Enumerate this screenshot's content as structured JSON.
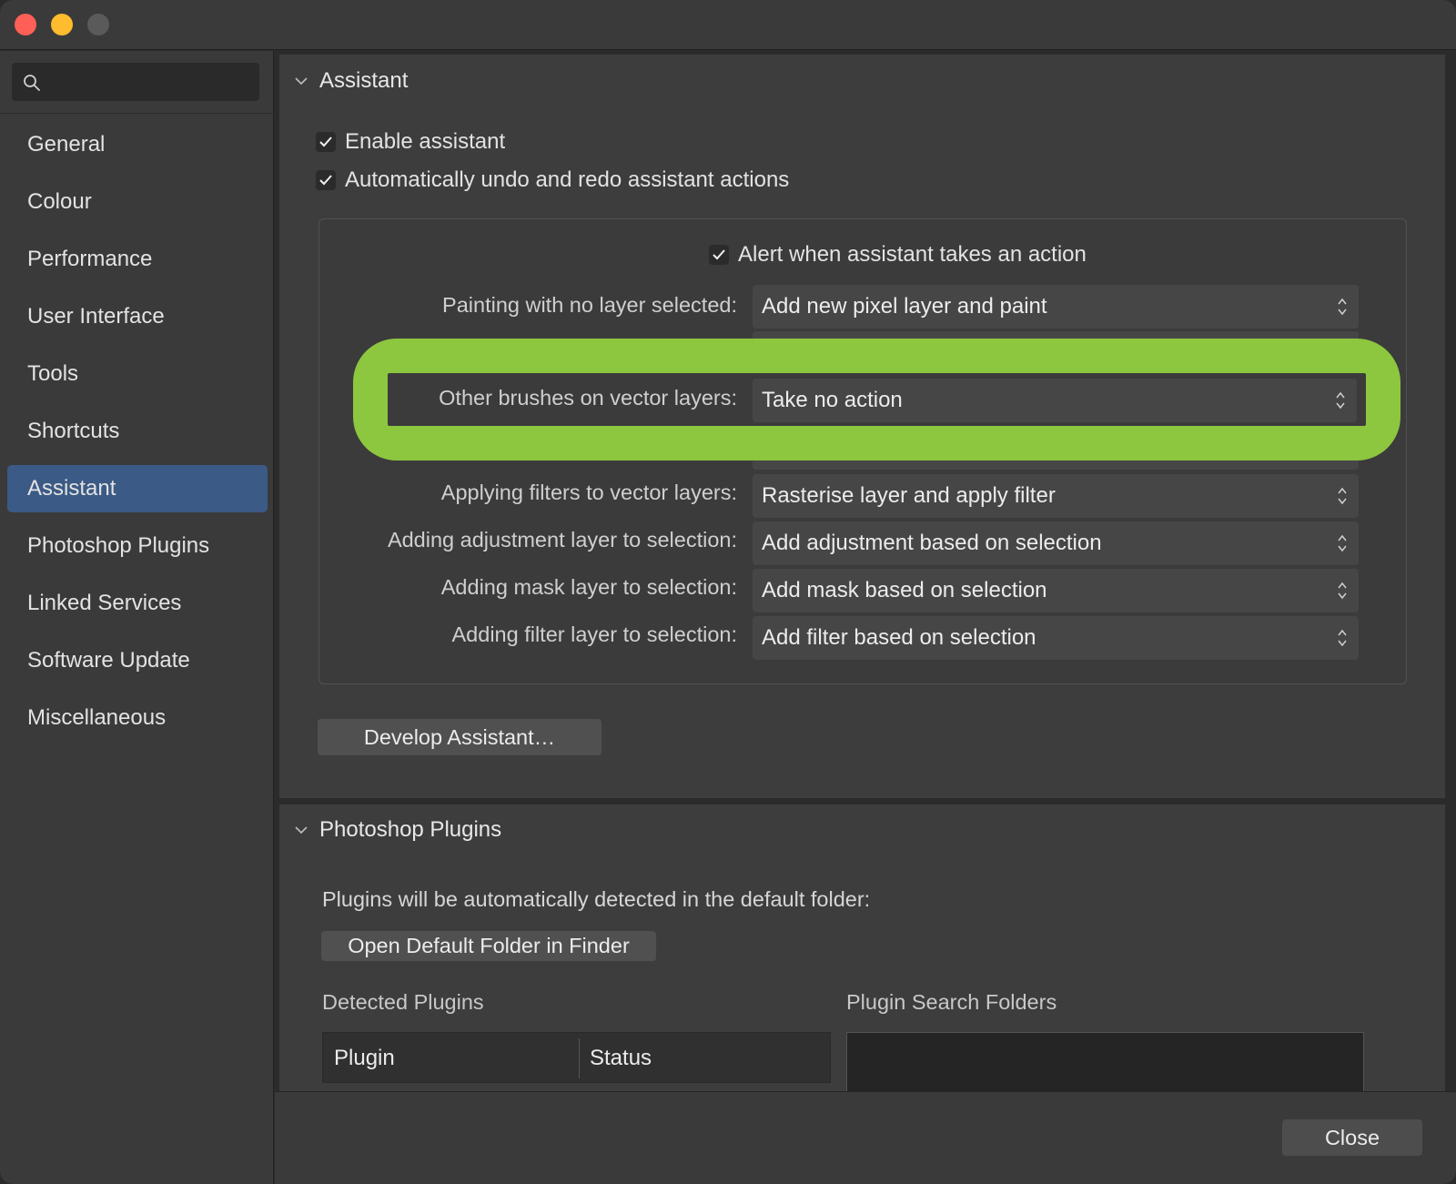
{
  "window": {
    "controls": [
      "close",
      "minimize",
      "zoom"
    ]
  },
  "sidebar": {
    "search": {
      "placeholder": "",
      "value": ""
    },
    "items": [
      {
        "label": "General"
      },
      {
        "label": "Colour"
      },
      {
        "label": "Performance"
      },
      {
        "label": "User Interface"
      },
      {
        "label": "Tools"
      },
      {
        "label": "Shortcuts"
      },
      {
        "label": "Assistant",
        "active": true
      },
      {
        "label": "Photoshop Plugins"
      },
      {
        "label": "Linked Services"
      },
      {
        "label": "Software Update"
      },
      {
        "label": "Miscellaneous"
      }
    ]
  },
  "assistant": {
    "title": "Assistant",
    "enable_assistant": {
      "label": "Enable assistant",
      "checked": true
    },
    "auto_undo_redo": {
      "label": "Automatically undo and redo assistant actions",
      "checked": true
    },
    "alert_action": {
      "label": "Alert when assistant takes an action",
      "checked": true
    },
    "rows": [
      {
        "label": "Painting with no layer selected:",
        "value": "Add new pixel layer and paint"
      },
      {
        "label": "Other brushes on vector layers:",
        "value": "Take no action"
      },
      {
        "label": "Applying filters to vector layers:",
        "value": "Rasterise layer and apply filter"
      },
      {
        "label": "Adding adjustment layer to selection:",
        "value": "Add adjustment based on selection"
      },
      {
        "label": "Adding mask layer to selection:",
        "value": "Add mask based on selection"
      },
      {
        "label": "Adding filter layer to selection:",
        "value": "Add filter based on selection"
      }
    ],
    "develop_button": "Develop Assistant…",
    "highlight_color": "#8dc63f"
  },
  "plugins": {
    "title": "Photoshop Plugins",
    "description": "Plugins will be automatically detected in the default folder:",
    "open_folder_button": "Open Default Folder in Finder",
    "detected_label": "Detected Plugins",
    "search_folders_label": "Plugin Search Folders",
    "columns": [
      "Plugin",
      "Status"
    ]
  },
  "footer": {
    "close_button": "Close"
  },
  "colors": {
    "active_item": "#3b5a85",
    "traffic_close": "#fe5f57",
    "traffic_minimize": "#febc2e",
    "traffic_zoom": "#5a5a5a"
  }
}
